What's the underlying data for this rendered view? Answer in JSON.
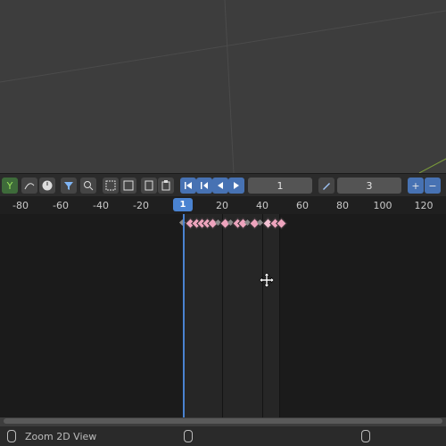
{
  "viewport": {
    "name": "3D Viewport"
  },
  "toolbar": {
    "current_frame": "1",
    "step_value": "3"
  },
  "ruler": {
    "ticks": [
      "-80",
      "-60",
      "-40",
      "-20",
      "20",
      "40",
      "60",
      "80",
      "100",
      "120"
    ],
    "current_frame_badge": "1"
  },
  "status": {
    "hint": "Zoom 2D View"
  },
  "colors": {
    "accent": "#4a83d1",
    "keyframe": "#eda4bd",
    "timeline_bg": "#1b1b1b"
  },
  "icons": [
    "y-axis-icon",
    "curve-icon",
    "clock-icon",
    "filter-icon",
    "zoom-icon",
    "frame-all-icon",
    "select-box-icon",
    "copy-icon",
    "paste-icon",
    "jump-start-icon",
    "prev-keyframe-icon",
    "play-reverse-icon",
    "play-icon",
    "pencil-icon",
    "plus-icon",
    "minus-icon",
    "move-cursor-icon",
    "mouse-icon"
  ]
}
